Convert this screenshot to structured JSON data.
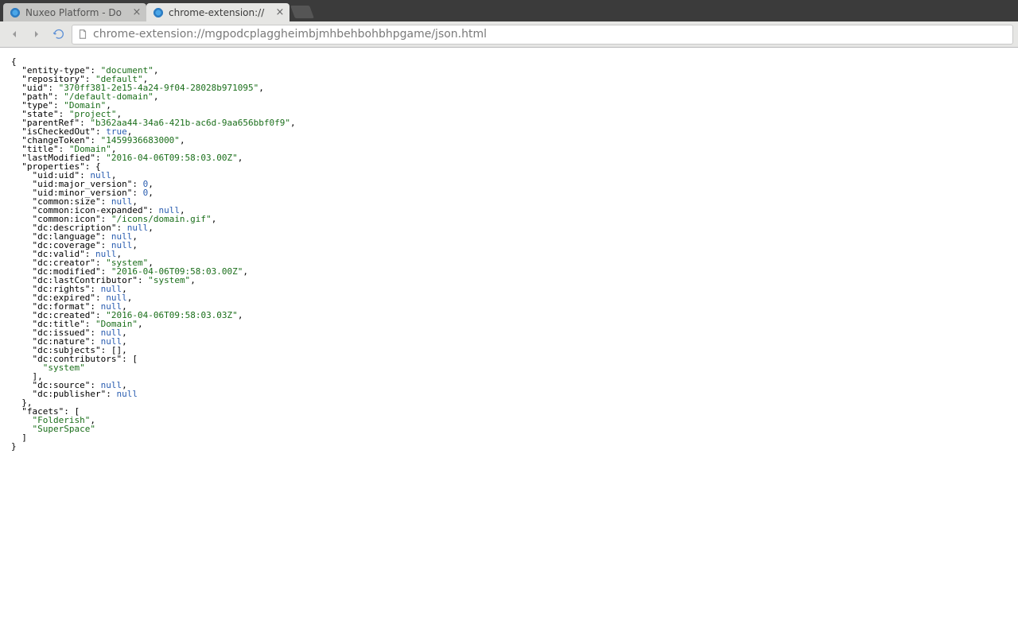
{
  "tabstrip": {
    "tabs": [
      {
        "title": "Nuxeo Platform - Do",
        "active": false
      },
      {
        "title": "chrome-extension://",
        "active": true
      }
    ]
  },
  "toolbar": {
    "url": "chrome-extension://mgpodcplaggheimbjmhbehbohbhpgame/json.html"
  },
  "json_doc": {
    "entity-type": "document",
    "repository": "default",
    "uid": "370ff381-2e15-4a24-9f04-28028b971095",
    "path": "/default-domain",
    "type": "Domain",
    "state": "project",
    "parentRef": "b362aa44-34a6-421b-ac6d-9aa656bbf0f9",
    "isCheckedOut": true,
    "changeToken": "1459936683000",
    "title": "Domain",
    "lastModified": "2016-04-06T09:58:03.00Z",
    "properties": {
      "uid:uid": null,
      "uid:major_version": 0,
      "uid:minor_version": 0,
      "common:size": null,
      "common:icon-expanded": null,
      "common:icon": "/icons/domain.gif",
      "dc:description": null,
      "dc:language": null,
      "dc:coverage": null,
      "dc:valid": null,
      "dc:creator": "system",
      "dc:modified": "2016-04-06T09:58:03.00Z",
      "dc:lastContributor": "system",
      "dc:rights": null,
      "dc:expired": null,
      "dc:format": null,
      "dc:created": "2016-04-06T09:58:03.03Z",
      "dc:title": "Domain",
      "dc:issued": null,
      "dc:nature": null,
      "dc:subjects": [],
      "dc:contributors": [
        "system"
      ],
      "dc:source": null,
      "dc:publisher": null
    },
    "facets": [
      "Folderish",
      "SuperSpace"
    ]
  }
}
